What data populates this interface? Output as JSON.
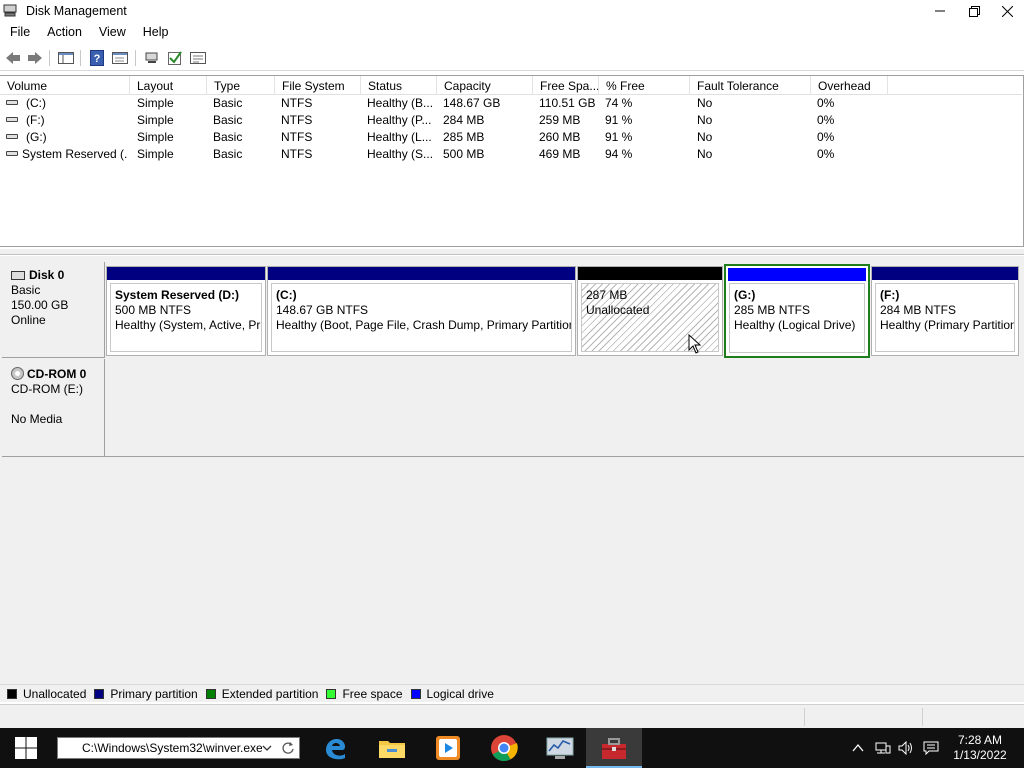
{
  "window": {
    "title": "Disk Management",
    "controls": {
      "minimize": "–",
      "restore": "❐",
      "close": "✕"
    }
  },
  "menu": [
    "File",
    "Action",
    "View",
    "Help"
  ],
  "toolbar": {
    "icons": [
      "back-arrow-icon",
      "forward-arrow-icon",
      "console-tree-icon",
      "help-icon",
      "properties-icon",
      "connect-icon",
      "check-icon",
      "settings-icon"
    ]
  },
  "volume_list": {
    "columns": [
      "Volume",
      "Layout",
      "Type",
      "File System",
      "Status",
      "Capacity",
      "Free Spa...",
      "% Free",
      "Fault Tolerance",
      "Overhead"
    ],
    "rows": [
      {
        "volume": "(C:)",
        "layout": "Simple",
        "type": "Basic",
        "fs": "NTFS",
        "status": "Healthy (B...",
        "capacity": "148.67 GB",
        "free": "110.51 GB",
        "pct": "74 %",
        "fault": "No",
        "overhead": "0%"
      },
      {
        "volume": "(F:)",
        "layout": "Simple",
        "type": "Basic",
        "fs": "NTFS",
        "status": "Healthy (P...",
        "capacity": "284 MB",
        "free": "259 MB",
        "pct": "91 %",
        "fault": "No",
        "overhead": "0%"
      },
      {
        "volume": "(G:)",
        "layout": "Simple",
        "type": "Basic",
        "fs": "NTFS",
        "status": "Healthy (L...",
        "capacity": "285 MB",
        "free": "260 MB",
        "pct": "91 %",
        "fault": "No",
        "overhead": "0%"
      },
      {
        "volume": "System Reserved (...",
        "layout": "Simple",
        "type": "Basic",
        "fs": "NTFS",
        "status": "Healthy (S...",
        "capacity": "500 MB",
        "free": "469 MB",
        "pct": "94 %",
        "fault": "No",
        "overhead": "0%"
      }
    ]
  },
  "disk0": {
    "name": "Disk 0",
    "kind": "Basic",
    "size": "150.00 GB",
    "state": "Online",
    "partitions": [
      {
        "name": "System Reserved  (D:)",
        "size": "500 MB NTFS",
        "status": "Healthy (System, Active, Primary Partition)",
        "bar": "#000080"
      },
      {
        "name": "(C:)",
        "size": "148.67 GB NTFS",
        "status": "Healthy (Boot, Page File, Crash Dump, Primary Partition)",
        "bar": "#000080"
      },
      {
        "name": "",
        "size": "287 MB",
        "status": "Unallocated",
        "bar": "#000000"
      },
      {
        "name": "(G:)",
        "size": "285 MB NTFS",
        "status": "Healthy (Logical Drive)",
        "bar": "#0000ff"
      },
      {
        "name": "(F:)",
        "size": "284 MB NTFS",
        "status": "Healthy (Primary Partition)",
        "bar": "#000080"
      }
    ]
  },
  "cdrom0": {
    "name": "CD-ROM 0",
    "drive": "CD-ROM (E:)",
    "media": "No Media"
  },
  "legend": [
    {
      "label": "Unallocated",
      "color": "#000000"
    },
    {
      "label": "Primary partition",
      "color": "#000080"
    },
    {
      "label": "Extended partition",
      "color": "#007f00"
    },
    {
      "label": "Free space",
      "color": "#33ff33"
    },
    {
      "label": "Logical drive",
      "color": "#0000ff"
    }
  ],
  "taskbar": {
    "run_value": "C:\\Windows\\System32\\winver.exe",
    "apps": [
      "edge-icon",
      "file-explorer-icon",
      "media-player-icon",
      "chrome-icon",
      "performance-monitor-icon",
      "toolbox-icon"
    ],
    "time": "7:28 AM",
    "date": "1/13/2022"
  }
}
